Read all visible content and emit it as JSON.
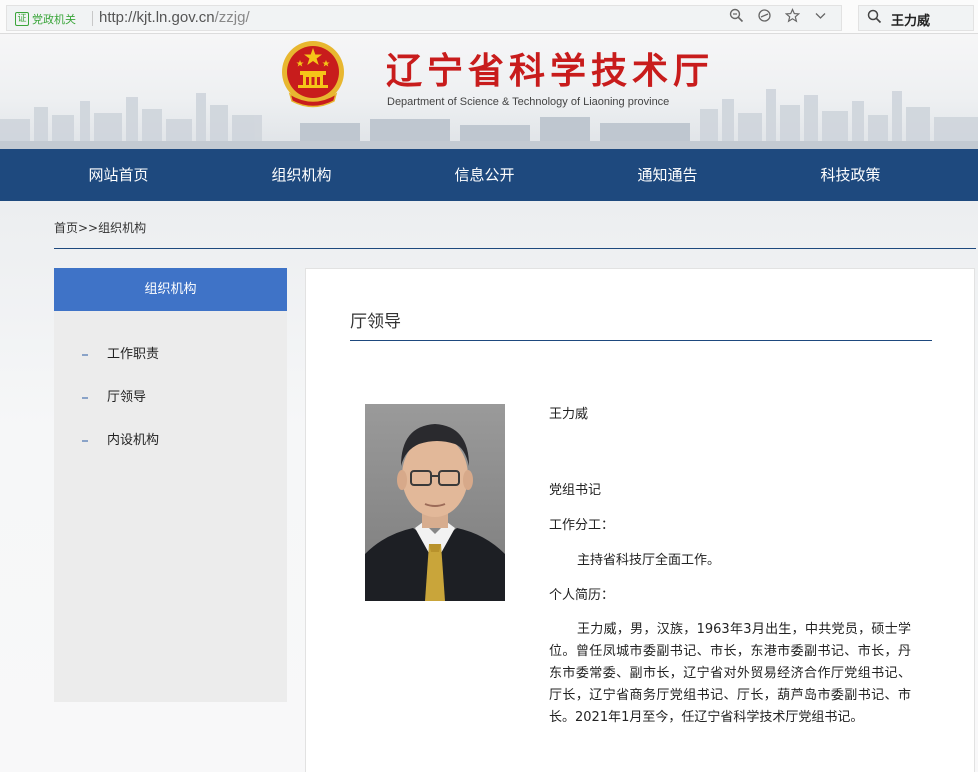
{
  "browser": {
    "gov_badge_icon": "cert-icon",
    "gov_badge_text": "党政机关",
    "url_host": "http://kjt.ln.gov.cn",
    "url_path": "/zzjg/",
    "icons": [
      "zoom-icon",
      "reader-icon",
      "star-icon",
      "chevron-down-icon"
    ],
    "search_query": "王力威"
  },
  "header": {
    "title": "辽宁省科学技术厅",
    "subtitle": "Department of Science & Technology of Liaoning province",
    "emblem_colors": {
      "red": "#c81c1c",
      "gold": "#e8b730"
    }
  },
  "nav": {
    "items": [
      "网站首页",
      "组织机构",
      "信息公开",
      "通知通告",
      "科技政策"
    ],
    "bg_color": "#1e497e"
  },
  "breadcrumb": "首页>>组织机构",
  "sidebar": {
    "heading": "组织机构",
    "items": [
      "工作职责",
      "厅领导",
      "内设机构"
    ],
    "accent_color": "#3f73c7"
  },
  "content": {
    "section_title": "厅领导",
    "leader": {
      "name": "王力威",
      "post": "党组书记",
      "duties_label": "工作分工：",
      "duties": "主持省科技厅全面工作。",
      "resume_label": "个人简历：",
      "resume": "王力威，男，汉族，1963年3月出生，中共党员，硕士学位。曾任凤城市委副书记、市长，东港市委副书记、市长，丹东市委常委、副市长，辽宁省对外贸易经济合作厅党组书记、厅长，辽宁省商务厅党组书记、厅长，葫芦岛市委副书记、市长。2021年1月至今，任辽宁省科学技术厅党组书记。"
    }
  }
}
